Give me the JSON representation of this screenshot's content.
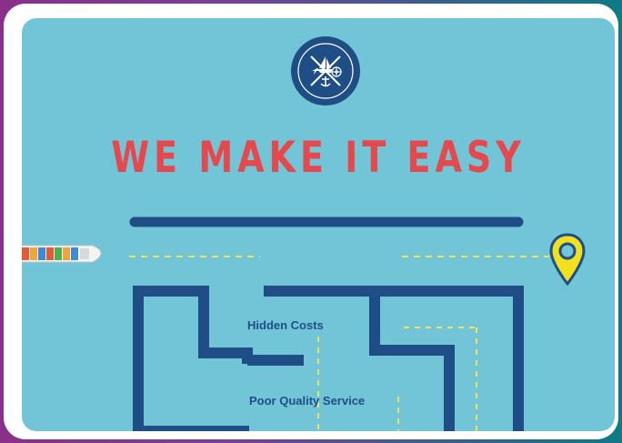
{
  "headline": "WE MAKE IT EASY",
  "maze_labels": {
    "hidden_costs": "Hidden Costs",
    "poor_quality_service": "Poor Quality Service"
  },
  "icons": {
    "logo": "anchor-compass-ship-badge-icon",
    "ship": "container-ship-icon",
    "pin": "location-pin-icon"
  },
  "colors": {
    "background": "#72c5d6",
    "headline": "#e5484d",
    "maze": "#1f4e87",
    "path_dashes": "#f2e25a",
    "pin": "#f2df1d"
  }
}
